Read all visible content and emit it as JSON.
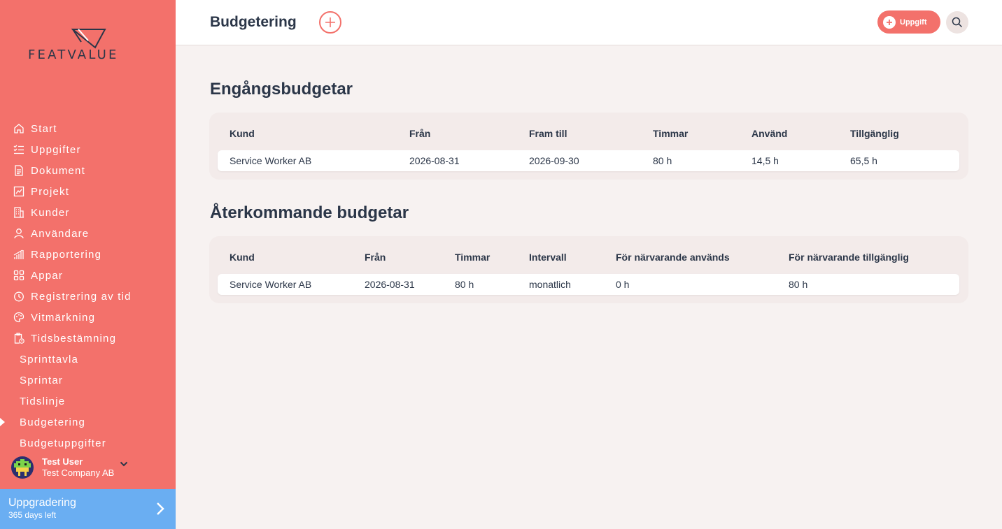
{
  "brand": {
    "logo_text": "FEATVALUE"
  },
  "nav": {
    "items": [
      {
        "label": "Start",
        "icon": "home-icon"
      },
      {
        "label": "Uppgifter",
        "icon": "checklist-icon"
      },
      {
        "label": "Dokument",
        "icon": "document-icon"
      },
      {
        "label": "Projekt",
        "icon": "chart-board-icon"
      },
      {
        "label": "Kunder",
        "icon": "building-icon"
      },
      {
        "label": "Användare",
        "icon": "user-icon"
      },
      {
        "label": "Rapportering",
        "icon": "bar-chart-icon"
      },
      {
        "label": "Appar",
        "icon": "apps-icon"
      },
      {
        "label": "Registrering av tid",
        "icon": "timer-icon"
      },
      {
        "label": "Vitmärkning",
        "icon": "palette-icon"
      },
      {
        "label": "Tidsbestämning",
        "icon": "clipboard-clock-icon"
      }
    ],
    "sub_items": [
      {
        "label": "Sprinttavla"
      },
      {
        "label": "Sprintar"
      },
      {
        "label": "Tidslinje"
      },
      {
        "label": "Budgetering",
        "active": true
      },
      {
        "label": "Budgetuppgifter"
      }
    ]
  },
  "user": {
    "name": "Test User",
    "company": "Test Company AB"
  },
  "upgrade": {
    "title": "Uppgradering",
    "subtitle": "365 days left"
  },
  "header": {
    "title": "Budgetering",
    "task_button": "Uppgift"
  },
  "one_time": {
    "title": "Engångsbudgetar",
    "columns": [
      "Kund",
      "Från",
      "Fram till",
      "Timmar",
      "Använd",
      "Tillgänglig"
    ],
    "rows": [
      [
        "Service Worker AB",
        "2026-08-31",
        "2026-09-30",
        "80 h",
        "14,5 h",
        "65,5 h"
      ]
    ]
  },
  "recurring": {
    "title": "Återkommande budgetar",
    "columns": [
      "Kund",
      "Från",
      "Timmar",
      "Intervall",
      "För närvarande används",
      "För närvarande tillgänglig"
    ],
    "rows": [
      [
        "Service Worker AB",
        "2026-08-31",
        "80 h",
        "monatlich",
        "0 h",
        "80 h"
      ]
    ]
  },
  "colors": {
    "accent": "#f3716b",
    "upgrade": "#6aaef2",
    "text": "#2b3648",
    "background": "#f7f2f1"
  }
}
